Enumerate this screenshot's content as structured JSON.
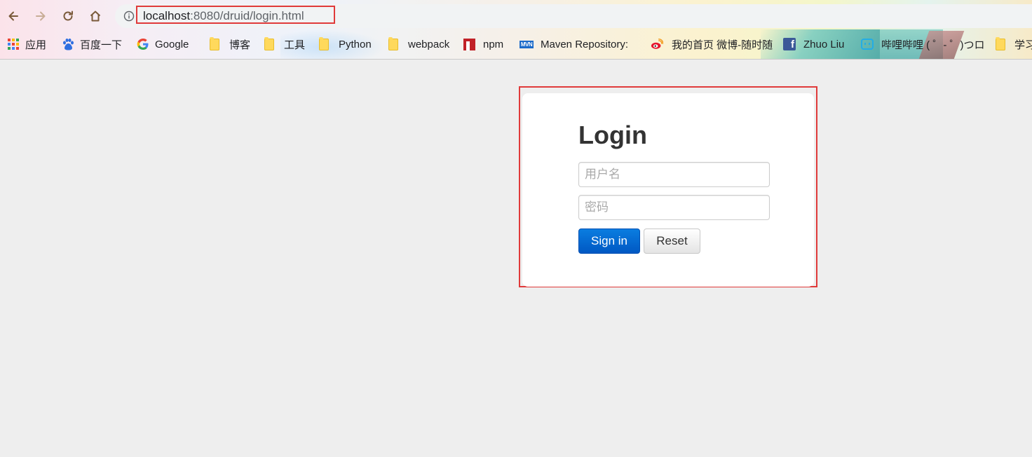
{
  "browser": {
    "url_host": "localhost",
    "url_rest": ":8080/druid/login.html"
  },
  "bookmarks": [
    {
      "label": "应用",
      "icon": "apps-grid-icon"
    },
    {
      "label": "百度一下",
      "icon": "baidu-paw-icon"
    },
    {
      "label": "Google",
      "icon": "google-icon"
    },
    {
      "label": "博客",
      "icon": "folder-icon"
    },
    {
      "label": "工具",
      "icon": "folder-icon"
    },
    {
      "label": "Python",
      "icon": "folder-icon"
    },
    {
      "label": "webpack",
      "icon": "folder-icon"
    },
    {
      "label": "npm",
      "icon": "npm-icon"
    },
    {
      "label": "Maven Repository:",
      "icon": "maven-icon"
    },
    {
      "label": "我的首页 微博-随时随",
      "icon": "weibo-icon"
    },
    {
      "label": "Zhuo Liu",
      "icon": "facebook-icon"
    },
    {
      "label": "哔哩哔哩 ( ゜- ゜)つロ",
      "icon": "bilibili-icon"
    },
    {
      "label": "学习",
      "icon": "folder-icon"
    }
  ],
  "login": {
    "title": "Login",
    "username_placeholder": "用户名",
    "password_placeholder": "密码",
    "signin_label": "Sign in",
    "reset_label": "Reset"
  },
  "colors": {
    "page_bg": "#eeeeee",
    "primary_button": "#0a6fd8",
    "highlight": "#e03a3a"
  }
}
